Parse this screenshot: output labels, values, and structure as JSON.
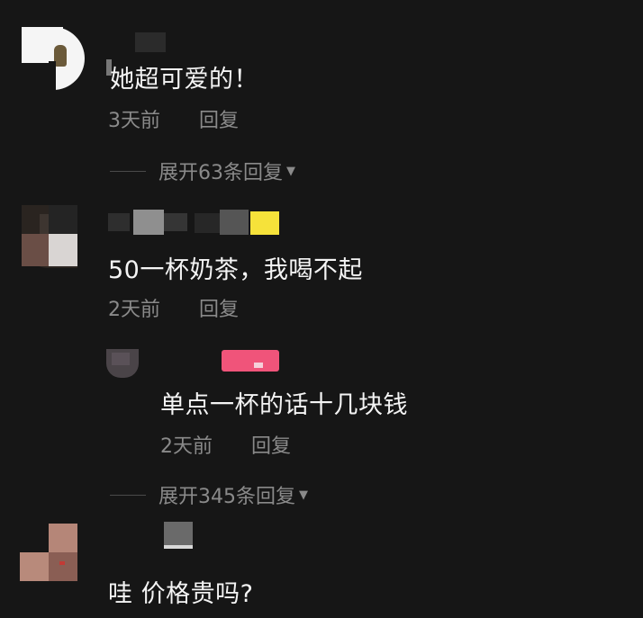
{
  "comments": [
    {
      "text": "她超可爱的！",
      "time": "3天前",
      "reply_label": "回复",
      "expand": {
        "text": "展开63条回复"
      }
    },
    {
      "text": "50一杯奶茶，我喝不起",
      "time": "2天前",
      "reply_label": "回复",
      "replies": [
        {
          "text": "单点一杯的话十几块钱",
          "time": "2天前",
          "reply_label": "回复"
        }
      ],
      "expand": {
        "text": "展开345条回复"
      }
    },
    {
      "text": "哇 价格贵吗?"
    }
  ],
  "icons": {
    "expand_caret": "caret-down-icon"
  },
  "colors": {
    "background": "#161616",
    "text_primary": "#f4f4f4",
    "text_secondary": "#8a8a8a",
    "badge_yellow": "#f6e23a",
    "badge_pink": "#f0547a"
  }
}
